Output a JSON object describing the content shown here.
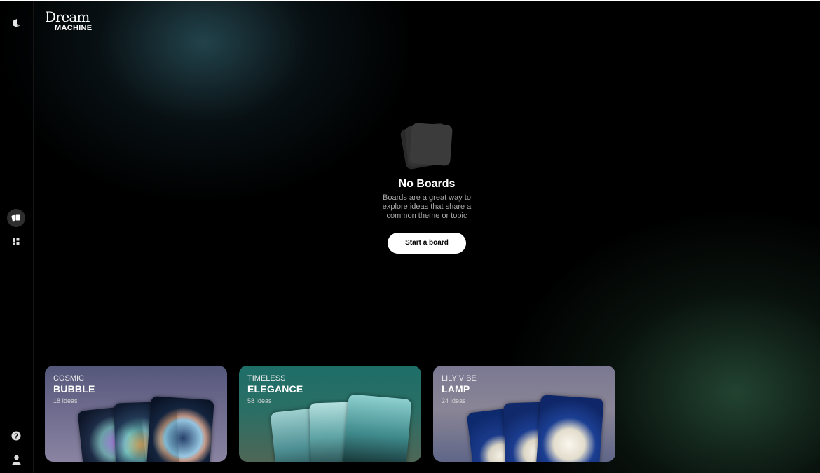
{
  "app": {
    "logo_line1": "Dream",
    "logo_line2": "MACHINE"
  },
  "sidebar": {
    "items": [
      {
        "icon": "luma-logo-icon"
      },
      {
        "icon": "boards-icon",
        "active": true
      },
      {
        "icon": "grid-icon"
      },
      {
        "icon": "help-icon"
      },
      {
        "icon": "profile-icon"
      }
    ]
  },
  "empty_state": {
    "title": "No Boards",
    "description": "Boards are a great way to explore ideas that share a common theme or topic",
    "button_label": "Start a board"
  },
  "featured_boards": [
    {
      "subtitle": "COSMIC",
      "title": "BUBBLE",
      "count": "18 Ideas"
    },
    {
      "subtitle": "TIMELESS",
      "title": "ELEGANCE",
      "count": "58 Ideas"
    },
    {
      "subtitle": "LILY VIBE",
      "title": "LAMP",
      "count": "24 Ideas"
    }
  ],
  "colors": {
    "background": "#000000",
    "button_bg": "#ffffff",
    "text_secondary": "#a8a8a8"
  }
}
